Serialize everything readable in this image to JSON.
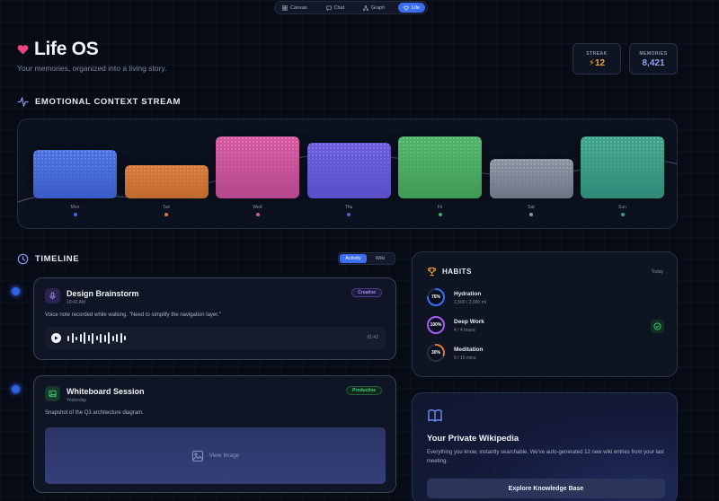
{
  "nav": {
    "tabs": [
      {
        "label": "Canvas",
        "icon": "grid-icon"
      },
      {
        "label": "Chat",
        "icon": "chat-icon"
      },
      {
        "label": "Graph",
        "icon": "graph-icon"
      },
      {
        "label": "Life",
        "icon": "heart-icon",
        "active": true
      }
    ]
  },
  "header": {
    "title": "Life OS",
    "subtitle": "Your memories, organized into a living story.",
    "stats": {
      "streak": {
        "label": "STREAK",
        "value": "⚡12"
      },
      "memories": {
        "label": "MEMORIES",
        "value": "8,421"
      }
    }
  },
  "stream": {
    "heading": "EMOTIONAL CONTEXT STREAM",
    "days": [
      {
        "day": "Mon",
        "level": 0.48,
        "colors": [
          "#4a72e0",
          "#3a5cc8"
        ],
        "dot": "#3b6df0"
      },
      {
        "day": "Tue",
        "level": 0.33,
        "colors": [
          "#d77a3a",
          "#c06a2e"
        ],
        "dot": "#e07a3b"
      },
      {
        "day": "Wed",
        "level": 0.62,
        "colors": [
          "#d75aa0",
          "#b4478d"
        ],
        "dot": "#d9579c"
      },
      {
        "day": "Thu",
        "level": 0.55,
        "colors": [
          "#6a5cdc",
          "#5a4fc8"
        ],
        "dot": "#5b5fd8"
      },
      {
        "day": "Fri",
        "level": 0.62,
        "colors": [
          "#4fb56a",
          "#3f9b56"
        ],
        "dot": "#43b060"
      },
      {
        "day": "Sat",
        "level": 0.39,
        "colors": [
          "#8e93a4",
          "#6f7485"
        ],
        "dot": "#8e93a4"
      },
      {
        "day": "Sun",
        "level": 0.62,
        "colors": [
          "#3fa58e",
          "#2f8a78"
        ],
        "dot": "#35a08a"
      }
    ]
  },
  "timeline": {
    "heading": "TIMELINE",
    "toggle": {
      "activity": "Activity",
      "wiki": "Wiki"
    },
    "entries": [
      {
        "title": "Design Brainstorm",
        "time": "10:42 AM",
        "tag": "Creative",
        "tag_color": "#8b6ce6",
        "description": "Voice note recorded while walking. \"Need to simplify the navigation layer.\"",
        "duration": "01:42"
      },
      {
        "title": "Whiteboard Session",
        "time": "Yesterday",
        "tag": "Productive",
        "tag_color": "#3fcf6e",
        "description": "Snapshot of the Q3 architecture diagram.",
        "image_label": "View Image"
      }
    ]
  },
  "habits": {
    "heading": "HABITS",
    "period": "Today",
    "items": [
      {
        "name": "Hydration",
        "detail": "1,500 / 2,000 ml",
        "percent_label": "75%",
        "progress": 0.75,
        "color": "#3b6df0"
      },
      {
        "name": "Deep Work",
        "detail": "4 / 4 hours",
        "percent_label": "100%",
        "progress": 1.0,
        "color": "#a35cf0"
      },
      {
        "name": "Meditation",
        "detail": "5 / 15 mins",
        "percent_label": "30%",
        "progress": 0.3,
        "color": "#e07a3b"
      }
    ]
  },
  "wiki": {
    "title": "Your Private Wikipedia",
    "description": "Everything you know, instantly searchable. We've auto-generated 12 new wiki entries from your last meeting.",
    "button": "Explore Knowledge Base"
  }
}
